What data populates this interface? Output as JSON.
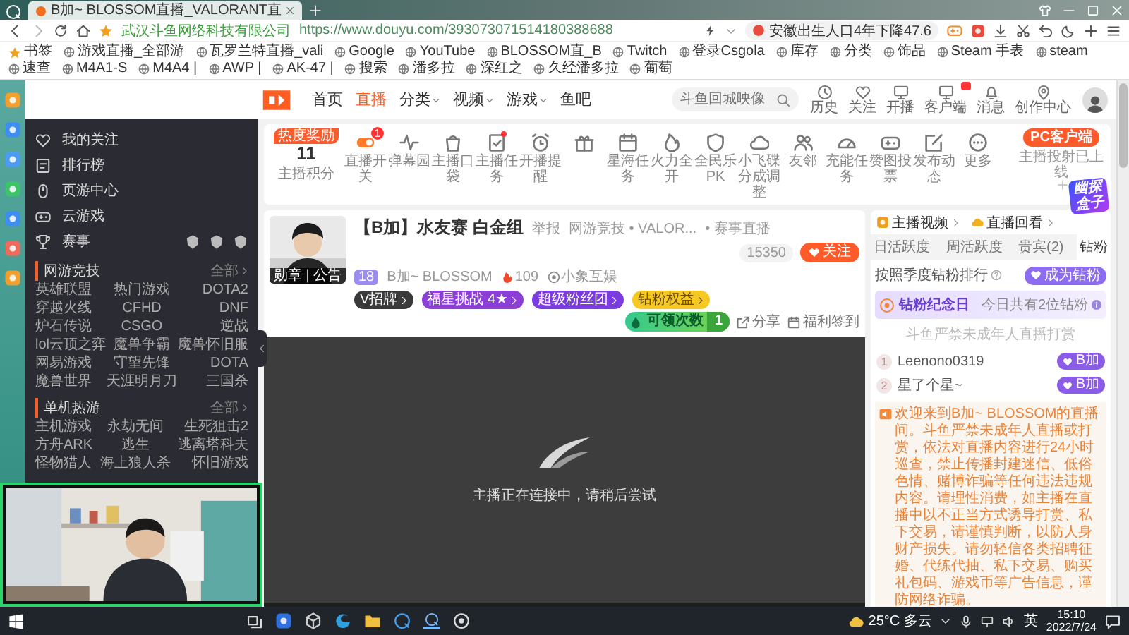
{
  "browser": {
    "tab_title": "B加~ BLOSSOM直播_VALORANT直",
    "site_owner": "武汉斗鱼网络科技有限公司",
    "url": "https://www.douyu.com/393073071514180388688",
    "hot_search": "安徽出生人口4年下降47.6",
    "bookmarks": [
      "书签",
      "游戏直播_全部游",
      "瓦罗兰特直播_vali",
      "Google",
      "YouTube",
      "BLOSSOM直_B",
      "Twitch",
      "登录Csgola",
      "库存",
      "分类",
      "饰品",
      "Steam 手表",
      "steam",
      "速查",
      "M4A1-S",
      "M4A4 |",
      "AWP |",
      "AK-47 |",
      "搜索",
      "潘多拉",
      "深红之",
      "久经潘多拉",
      "葡萄"
    ]
  },
  "header": {
    "nav": [
      {
        "label": "首页",
        "selected": false,
        "dropdown": false
      },
      {
        "label": "直播",
        "selected": true,
        "dropdown": false
      },
      {
        "label": "分类",
        "selected": false,
        "dropdown": true
      },
      {
        "label": "视频",
        "selected": false,
        "dropdown": true
      },
      {
        "label": "游戏",
        "selected": false,
        "dropdown": true
      },
      {
        "label": "鱼吧",
        "selected": false,
        "dropdown": false
      }
    ],
    "search": {
      "placeholder": "斗鱼回城映像"
    },
    "actions": [
      {
        "label": "历史",
        "badge": false
      },
      {
        "label": "关注",
        "badge": false
      },
      {
        "label": "开播",
        "badge": false
      },
      {
        "label": "客户端",
        "badge": true
      },
      {
        "label": "消息",
        "badge": false
      },
      {
        "label": "创作中心",
        "badge": false
      }
    ]
  },
  "sidebar": {
    "items": [
      {
        "label": "我的关注",
        "kind": "link"
      },
      {
        "label": "排行榜",
        "kind": "link"
      },
      {
        "label": "页游中心",
        "kind": "link"
      },
      {
        "label": "云游戏",
        "kind": "link"
      },
      {
        "label": "赛事",
        "kind": "events"
      }
    ],
    "sections": [
      {
        "title": "网游竞技",
        "more": "全部",
        "games": [
          "英雄联盟",
          "热门游戏",
          "DOTA2",
          "穿越火线",
          "CFHD",
          "DNF",
          "炉石传说",
          "CSGO",
          "逆战",
          "lol云顶之弈",
          "魔兽争霸",
          "魔兽怀旧服",
          "网易游戏",
          "守望先锋",
          "DOTA",
          "魔兽世界",
          "天涯明月刀",
          "三国杀"
        ]
      },
      {
        "title": "单机热游",
        "more": "全部",
        "games": [
          "主机游戏",
          "永劫无间",
          "生死狙击2",
          "方舟ARK",
          "逃生",
          "逃离塔科夫",
          "怪物猎人",
          "海上狼人杀",
          "怀旧游戏"
        ]
      }
    ]
  },
  "toolbar": {
    "hot_tag": "热度奖励",
    "score": "11",
    "score_label": "主播积分",
    "items": [
      {
        "kind": "labeled",
        "label": "直播开关",
        "badge": "1",
        "dot": false
      },
      {
        "kind": "labeled",
        "label": "弹幕园",
        "dot": false
      },
      {
        "kind": "labeled",
        "label": "主播口袋",
        "dot": false
      },
      {
        "kind": "labeled",
        "label": "主播任务",
        "dot": true
      },
      {
        "kind": "labeled",
        "label": "开播提醒",
        "dot": false
      },
      {
        "kind": "icon",
        "dot": false
      },
      {
        "kind": "labeled",
        "label": "星海任务",
        "dot": false
      },
      {
        "kind": "labeled",
        "label": "火力全开",
        "dot": false
      },
      {
        "kind": "labeled",
        "label": "全民乐PK",
        "dot": false
      },
      {
        "kind": "labeled",
        "label": "小飞碟分成调整",
        "dot": false
      },
      {
        "kind": "labeled",
        "label": "友邻",
        "dot": false
      },
      {
        "kind": "labeled",
        "label": "充能任务",
        "dot": false
      },
      {
        "kind": "labeled",
        "label": "赞图投票",
        "dot": false
      },
      {
        "kind": "labeled",
        "label": "发布动态",
        "dot": false
      },
      {
        "kind": "labeled",
        "label": "更多",
        "dot": false
      }
    ],
    "pc_button": "PC客户端",
    "pc_note": "主播投射已上线"
  },
  "streamer": {
    "avatar_caption": "勋章 | 公告",
    "title": "【B加】水友赛 白金组",
    "report": "举报",
    "category": "网游竞技 • VALOR...",
    "event": "• 赛事直播",
    "level": "18",
    "name": "B加~ BLOSSOM",
    "heat": "109",
    "company": "小象互娱",
    "badges": [
      {
        "label": "V招牌",
        "color": "#3a3a3a"
      },
      {
        "label": "福星挑战 4★",
        "color": "#8b3fd6"
      },
      {
        "label": "超级粉丝团",
        "color": "#7a3be0"
      },
      {
        "label": "钻粉权益",
        "color": "#f6c822"
      }
    ],
    "followers": "15350",
    "follow": "关注",
    "claim": "可领次数",
    "claim_count": "1",
    "share": "分享",
    "sign": "福利签到"
  },
  "player": {
    "status": "主播正在连接中，请稍后尝试"
  },
  "panel": {
    "links": [
      "主播视频",
      "直播回看"
    ],
    "promo": "幽探盒子",
    "tabs": [
      {
        "label": "日活跃度",
        "selected": false
      },
      {
        "label": "周活跃度",
        "selected": false
      },
      {
        "label": "贵宾(2)",
        "selected": false
      },
      {
        "label": "钻粉",
        "selected": true
      }
    ],
    "rank_note": "按照季度钻粉排行",
    "join": "成为钻粉",
    "anniv": "钻粉纪念日",
    "anniv_count": "今日共有2位钻粉",
    "minor_note": "斗鱼严禁未成年人直播打赏",
    "fans": [
      {
        "rank": "1",
        "name": "Leenono0319",
        "badge": "B加"
      },
      {
        "rank": "2",
        "name": "星了个星~",
        "badge": "B加"
      }
    ],
    "notice": "欢迎来到B加~ BLOSSOM的直播间。斗鱼严禁未成年人直播或打赏，依法对直播内容进行24小时巡查，禁止传播封建迷信、低俗色情、赌博诈骗等任何违法违规内容。请理性消费，如主播在直播中以不正当方式诱导打赏、私下交易，请谨慎判断，以防人身财产损失。请勿轻信各类招聘征婚、代练代抽、私下交易、购买礼包码、游戏币等广告信息，谨防网络诈骗。"
  },
  "taskbar": {
    "weather": "25°C 多云",
    "ime": "英",
    "time": "15:10",
    "date": "2022/7/24"
  }
}
